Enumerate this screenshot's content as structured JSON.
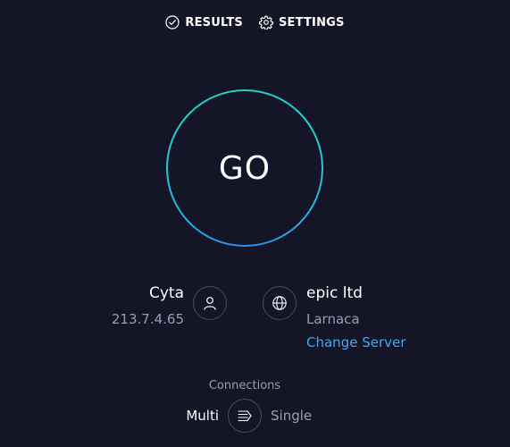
{
  "nav": {
    "results_label": "RESULTS",
    "settings_label": "SETTINGS"
  },
  "go": {
    "label": "GO"
  },
  "isp": {
    "name": "Cyta",
    "ip": "213.7.4.65"
  },
  "server": {
    "name": "epic ltd",
    "location": "Larnaca",
    "change_label": "Change Server"
  },
  "connections": {
    "label": "Connections",
    "multi_label": "Multi",
    "single_label": "Single",
    "selected": "Multi"
  },
  "colors": {
    "background": "#141526",
    "ring_start": "#21d6c2",
    "ring_end": "#2e8ee6",
    "link": "#3fa9f5",
    "muted_text": "#9b9cb0"
  },
  "icons": {
    "results": "check-circle-icon",
    "settings": "gear-icon",
    "isp": "user-icon",
    "server": "globe-icon",
    "connections": "connections-toggle-icon"
  }
}
